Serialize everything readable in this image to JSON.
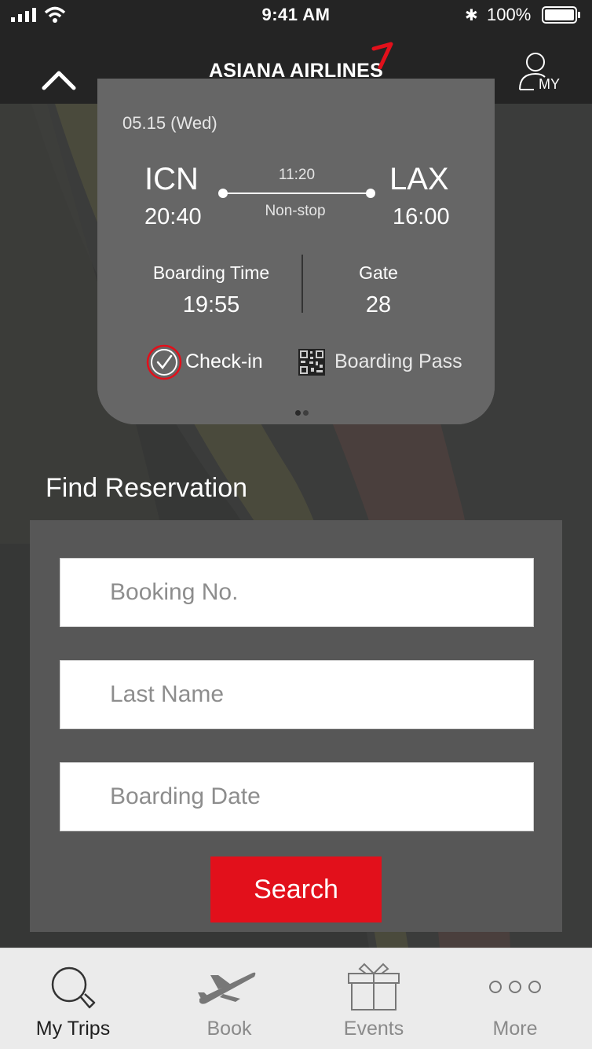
{
  "status_bar": {
    "time": "9:41 AM",
    "battery": "100%"
  },
  "header": {
    "brand": "ASIANA AIRLINES",
    "my_label": "MY"
  },
  "flight": {
    "date": "05.15 (Wed)",
    "origin": "ICN",
    "origin_time": "20:40",
    "destination": "LAX",
    "destination_time": "16:00",
    "duration": "11:20",
    "route_type": "Non-stop",
    "boarding_time_label": "Boarding Time",
    "boarding_time": "19:55",
    "gate_label": "Gate",
    "gate": "28",
    "checkin_label": "Check-in",
    "boarding_pass_label": "Boarding Pass"
  },
  "reservation": {
    "title": "Find Reservation",
    "booking_placeholder": "Booking No.",
    "lastname_placeholder": "Last Name",
    "date_placeholder": "Boarding Date",
    "search_label": "Search"
  },
  "tabs": [
    {
      "label": "My Trips",
      "icon": "search-icon",
      "active": true
    },
    {
      "label": "Book",
      "icon": "airplane-icon",
      "active": false
    },
    {
      "label": "Events",
      "icon": "gift-icon",
      "active": false
    },
    {
      "label": "More",
      "icon": "more-dots-icon",
      "active": false
    }
  ],
  "colors": {
    "brand_red": "#e2101b",
    "header_bg": "#242424",
    "card_bg": "#666666",
    "panel_bg": "#575757"
  }
}
